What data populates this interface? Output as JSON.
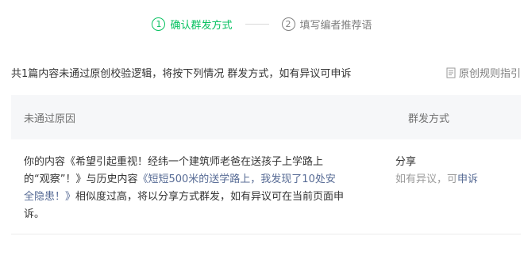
{
  "steps": [
    {
      "num": "1",
      "label": "确认群发方式"
    },
    {
      "num": "2",
      "label": "填写编者推荐语"
    }
  ],
  "summary": "共1篇内容未通过原创校验逻辑，将按下列情况 群发方式，如有异议可申诉",
  "rule_link": {
    "label": "原创规则指引",
    "icon": "doc-icon"
  },
  "table": {
    "headers": {
      "reason": "未通过原因",
      "mode": "群发方式"
    },
    "row": {
      "reason": {
        "p1": "你的内容《希望引起重视！经纬一个建筑师老爸在送孩子上学路上的“观察”！》与历史内容",
        "link": "《短短500米的送学路上，我发现了10处安全隐患！》",
        "p2": "相似度过高，将以分享方式群发，如有异议可在当前页面申诉。"
      },
      "mode": "分享",
      "appeal_prefix": "如有异议，可",
      "appeal_link": "申诉"
    }
  },
  "colors": {
    "accent": "#07c160",
    "link": "#576b95"
  }
}
